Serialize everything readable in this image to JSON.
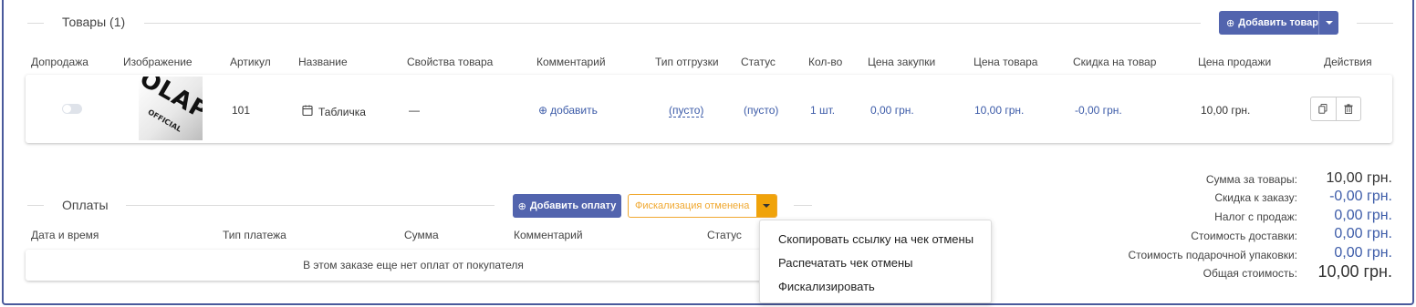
{
  "products": {
    "title": "Товары (1)",
    "add_button": "Добавить товар",
    "columns": [
      "Допродажа",
      "Изображение",
      "Артикул",
      "Название",
      "Свойства товара",
      "Комментарий",
      "Тип отгрузки",
      "Статус",
      "Кол-во",
      "Цена закупки",
      "Цена товара",
      "Скидка на товар",
      "Цена продажи",
      "Действия"
    ],
    "row": {
      "upsell_enabled": false,
      "image_text": "OLAPLEX",
      "image_subtext": "OFFICIAL",
      "sku": "101",
      "name": "Табличка",
      "properties": "—",
      "comment": "добавить",
      "shipment_type": "(пусто)",
      "status": "(пусто)",
      "qty": "1 шт.",
      "purchase_price": "0,00 грн.",
      "item_price": "10,00 грн.",
      "discount": "-0,00 грн.",
      "sale_price": "10,00 грн."
    }
  },
  "payments": {
    "title": "Оплаты",
    "add_button": "Добавить оплату",
    "fiscal_status": "Фискализация отменена",
    "columns": [
      "Дата и время",
      "Тип платежа",
      "Сумма",
      "Комментарий",
      "Статус"
    ],
    "empty_message": "В этом заказе еще нет оплат от покупателя",
    "dropdown_items": [
      "Скопировать ссылку на чек отмены",
      "Распечатать чек отмены",
      "Фискализировать"
    ]
  },
  "summary": [
    {
      "label": "Сумма за товары:",
      "value": "10,00 грн."
    },
    {
      "label": "Скидка к заказу:",
      "value": "-0,00 грн."
    },
    {
      "label": "Налог с продаж:",
      "value": "0,00 грн."
    },
    {
      "label": "Стоимость доставки:",
      "value": "0,00 грн."
    },
    {
      "label": "Стоимость подарочной упаковки:",
      "value": "0,00 грн."
    },
    {
      "label": "Общая стоимость:",
      "value": "10,00 грн."
    }
  ],
  "colors": {
    "primary": "#5264ae",
    "link": "#3c5ba8",
    "warning": "#f0a830",
    "frame": "#4a5a9c"
  }
}
